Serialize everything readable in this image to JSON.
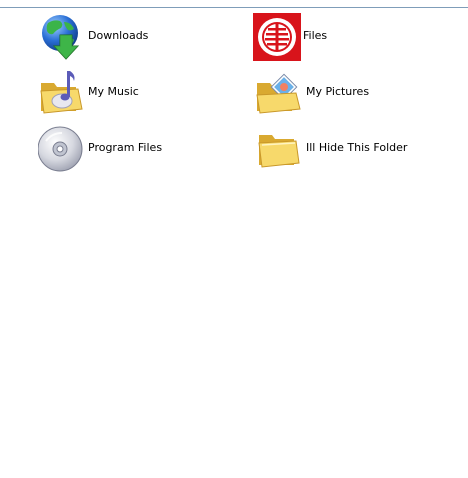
{
  "items": [
    {
      "label": "Downloads",
      "icon": "globe-download-icon"
    },
    {
      "label": "Files",
      "icon": "element-logo-icon"
    },
    {
      "label": "My Music",
      "icon": "music-folder-icon"
    },
    {
      "label": "My Pictures",
      "icon": "pictures-folder-icon"
    },
    {
      "label": "Program Files",
      "icon": "cd-disc-icon"
    },
    {
      "label": "Ill Hide This Folder",
      "icon": "folder-icon"
    }
  ],
  "colors": {
    "folder": "#f7d96b",
    "folder_dark": "#d9a930",
    "globe_blue": "#2a6fd6",
    "globe_green": "#3bb449",
    "arrow_green": "#2fa83a",
    "element_red": "#d8141b",
    "music_note": "#5b5bb8",
    "disc_silver": "#d6d8e0"
  }
}
